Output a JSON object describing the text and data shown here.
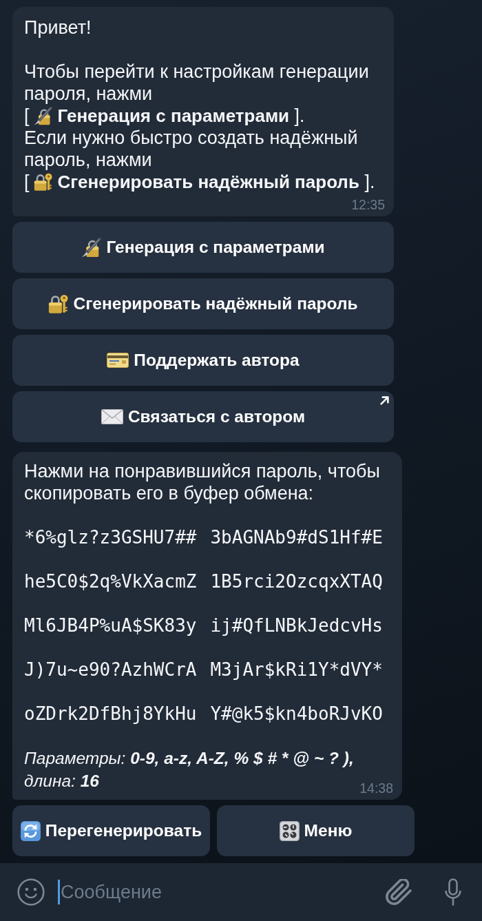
{
  "intro_message": {
    "paragraphs": [
      {
        "lines": [
          {
            "kind": "text",
            "text": "Привет!"
          }
        ]
      },
      {
        "lines": [
          {
            "kind": "text",
            "text": "Чтобы перейти к настройкам генерации пароля, нажми"
          },
          {
            "kind": "command",
            "open": "[",
            "label": "Генерация с параметрами",
            "close": "]."
          },
          {
            "kind": "text",
            "text": "Если нужно быстро создать надёжный пароль, нажми"
          },
          {
            "kind": "command",
            "open": "[",
            "label": "Сгенерировать надёжный пароль",
            "close": "]."
          }
        ]
      }
    ],
    "time": "12:35"
  },
  "intro_buttons": [
    {
      "label": "Генерация с параметрами",
      "link": false
    },
    {
      "label": "Сгенерировать надёжный пароль",
      "link": false
    },
    {
      "label": "Поддержать автора",
      "link": false
    },
    {
      "label": "Связаться с автором",
      "link": true
    }
  ],
  "passwords_message": {
    "text": "Нажми на понравившийся пароль, чтобы скопировать его в буфер обмена:",
    "passwords": [
      "*6%glz?z3GSHU7##",
      "3bAGNAb9#dS1Hf#E",
      "he5C0$2q%VkXacmZ",
      "1B5rci2OzcqxXTAQ",
      "Ml6JB4P%uA$SK83y",
      "ij#QfLNBkJedcvHs",
      "J)7u~e90?AzhWCrA",
      "M3jAr$kRi1Y*dVY*",
      "oZDrk2DfBhj8YkHu",
      "Y#@k5$kn4boRJvKO"
    ],
    "parameters": [
      {
        "text": "Параметры: ",
        "bold": false
      },
      {
        "text": "0-9, a-z, A-Z, % $ # * @ ~ ? ),",
        "bold": true
      },
      {
        "text": " длина: ",
        "bold": false
      },
      {
        "text": "16",
        "bold": true
      }
    ],
    "time": "14:38"
  },
  "passwords_buttons": [
    {
      "label": "Перегенерировать"
    },
    {
      "label": "Меню"
    }
  ],
  "composer": {
    "placeholder": "Сообщение"
  }
}
